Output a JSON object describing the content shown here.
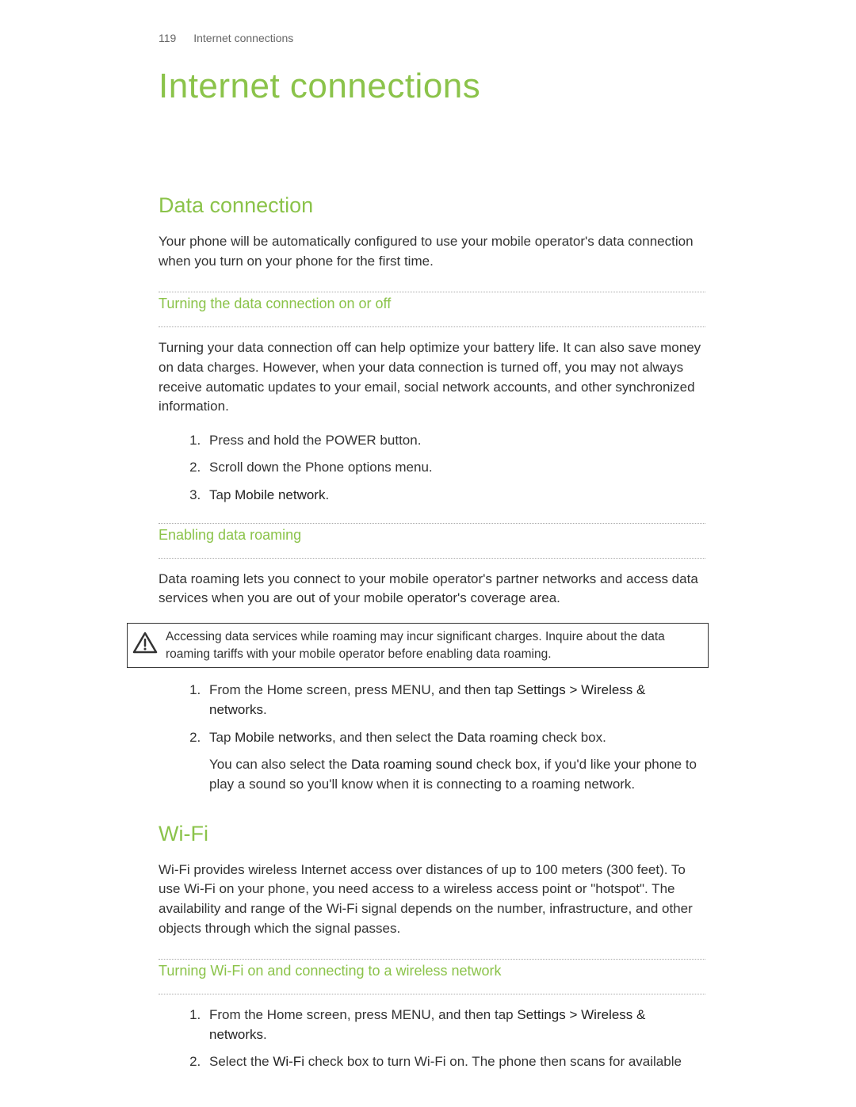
{
  "header": {
    "page_number": "119",
    "section": "Internet connections"
  },
  "title": "Internet connections",
  "data_connection": {
    "heading": "Data connection",
    "intro": "Your phone will be automatically configured to use your mobile operator's data connection when you turn on your phone for the first time.",
    "sub1": {
      "heading": "Turning the data connection on or off",
      "body": "Turning your data connection off can help optimize your battery life. It can also save money on data charges. However, when your data connection is turned off, you may not always receive automatic updates to your email, social network accounts, and other synchronized information.",
      "steps": {
        "s1": "Press and hold the POWER button.",
        "s2": "Scroll down the Phone options menu.",
        "s3_a": "Tap ",
        "s3_b": "Mobile network",
        "s3_c": "."
      }
    },
    "sub2": {
      "heading": "Enabling data roaming",
      "body": "Data roaming lets you connect to your mobile operator's partner networks and access data services when you are out of your mobile operator's coverage area.",
      "warning": "Accessing data services while roaming may incur significant charges. Inquire about the data roaming tariffs with your mobile operator before enabling data roaming.",
      "steps": {
        "s1_a": "From the Home screen, press MENU, and then tap ",
        "s1_b": "Settings > Wireless & networks",
        "s1_c": ".",
        "s2_a": "Tap ",
        "s2_b": "Mobile networks",
        "s2_c": ", and then select the ",
        "s2_d": "Data roaming",
        "s2_e": " check box.",
        "s2_sub_a": "You can also select the ",
        "s2_sub_b": "Data roaming sound",
        "s2_sub_c": " check box, if you'd like your phone to play a sound so you'll know when it is connecting to a roaming network."
      }
    }
  },
  "wifi": {
    "heading": "Wi-Fi",
    "intro": "Wi-Fi provides wireless Internet access over distances of up to 100 meters (300 feet). To use Wi-Fi on your phone, you need access to a wireless access point or \"hotspot\". The availability and range of the Wi-Fi signal depends on the number, infrastructure, and other objects through which the signal passes.",
    "sub1": {
      "heading": "Turning Wi-Fi on and connecting to a wireless network",
      "steps": {
        "s1_a": "From the Home screen, press MENU, and then tap ",
        "s1_b": "Settings > Wireless & networks",
        "s1_c": ".",
        "s2_a": "Select the ",
        "s2_b": "Wi-Fi",
        "s2_c": " check box to turn Wi-Fi on. The phone then scans for available"
      }
    }
  }
}
